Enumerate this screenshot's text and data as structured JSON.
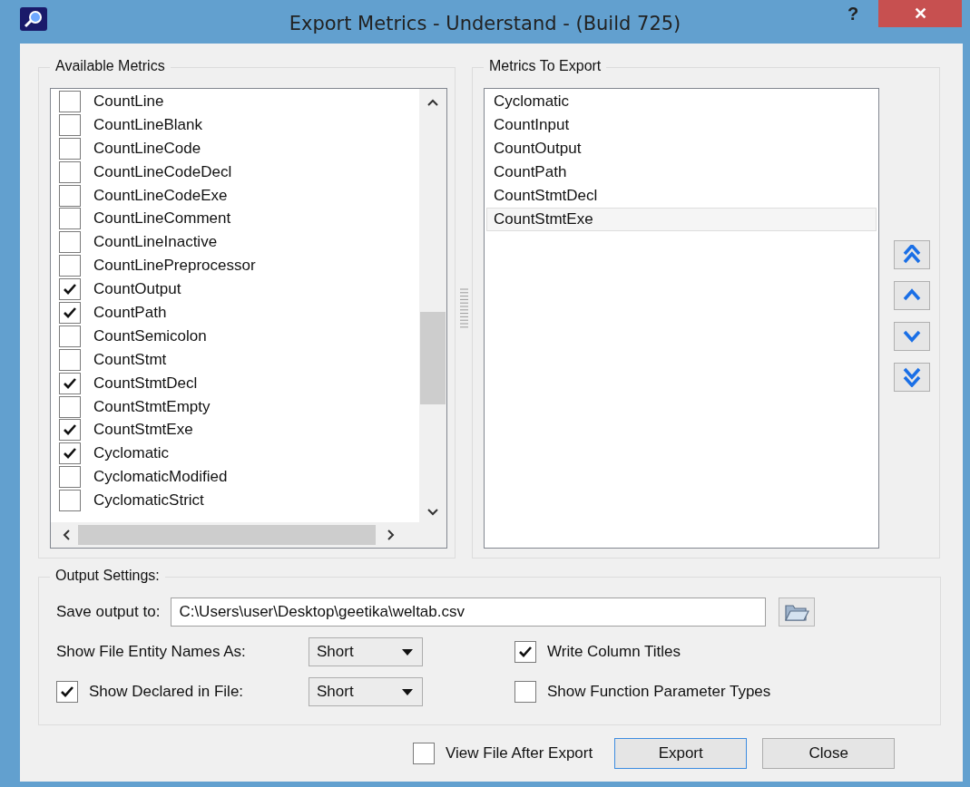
{
  "window": {
    "title": "Export Metrics - Understand - (Build 725)",
    "help": "?",
    "close": "✕"
  },
  "available_metrics": {
    "title": "Available Metrics",
    "items": [
      {
        "label": "CountLine",
        "checked": false
      },
      {
        "label": "CountLineBlank",
        "checked": false
      },
      {
        "label": "CountLineCode",
        "checked": false
      },
      {
        "label": "CountLineCodeDecl",
        "checked": false
      },
      {
        "label": "CountLineCodeExe",
        "checked": false
      },
      {
        "label": "CountLineComment",
        "checked": false
      },
      {
        "label": "CountLineInactive",
        "checked": false
      },
      {
        "label": "CountLinePreprocessor",
        "checked": false
      },
      {
        "label": "CountOutput",
        "checked": true
      },
      {
        "label": "CountPath",
        "checked": true
      },
      {
        "label": "CountSemicolon",
        "checked": false
      },
      {
        "label": "CountStmt",
        "checked": false
      },
      {
        "label": "CountStmtDecl",
        "checked": true
      },
      {
        "label": "CountStmtEmpty",
        "checked": false
      },
      {
        "label": "CountStmtExe",
        "checked": true
      },
      {
        "label": "Cyclomatic",
        "checked": true
      },
      {
        "label": "CyclomaticModified",
        "checked": false
      },
      {
        "label": "CyclomaticStrict",
        "checked": false
      }
    ]
  },
  "metrics_to_export": {
    "title": "Metrics To Export",
    "items": [
      {
        "label": "Cyclomatic",
        "selected": false
      },
      {
        "label": "CountInput",
        "selected": false
      },
      {
        "label": "CountOutput",
        "selected": false
      },
      {
        "label": "CountPath",
        "selected": false
      },
      {
        "label": "CountStmtDecl",
        "selected": false
      },
      {
        "label": "CountStmtExe",
        "selected": true
      }
    ]
  },
  "output_settings": {
    "title": "Output Settings:",
    "save_output_to": {
      "label": "Save output to:",
      "value": "C:\\Users\\user\\Desktop\\geetika\\weltab.csv"
    },
    "show_file_entity_names_as": {
      "label": "Show File Entity Names As:",
      "value": "Short"
    },
    "show_declared_in_file": {
      "label": "Show Declared in File:",
      "checked": true,
      "value": "Short"
    },
    "write_column_titles": {
      "label": "Write Column Titles",
      "checked": true
    },
    "show_function_parameter_types": {
      "label": "Show Function Parameter Types",
      "checked": false
    }
  },
  "view_file_after_export": {
    "label": "View File After Export",
    "checked": false
  },
  "buttons": [
    {
      "label": "Export",
      "kind": "default"
    },
    {
      "label": "Close",
      "kind": "normal"
    }
  ]
}
